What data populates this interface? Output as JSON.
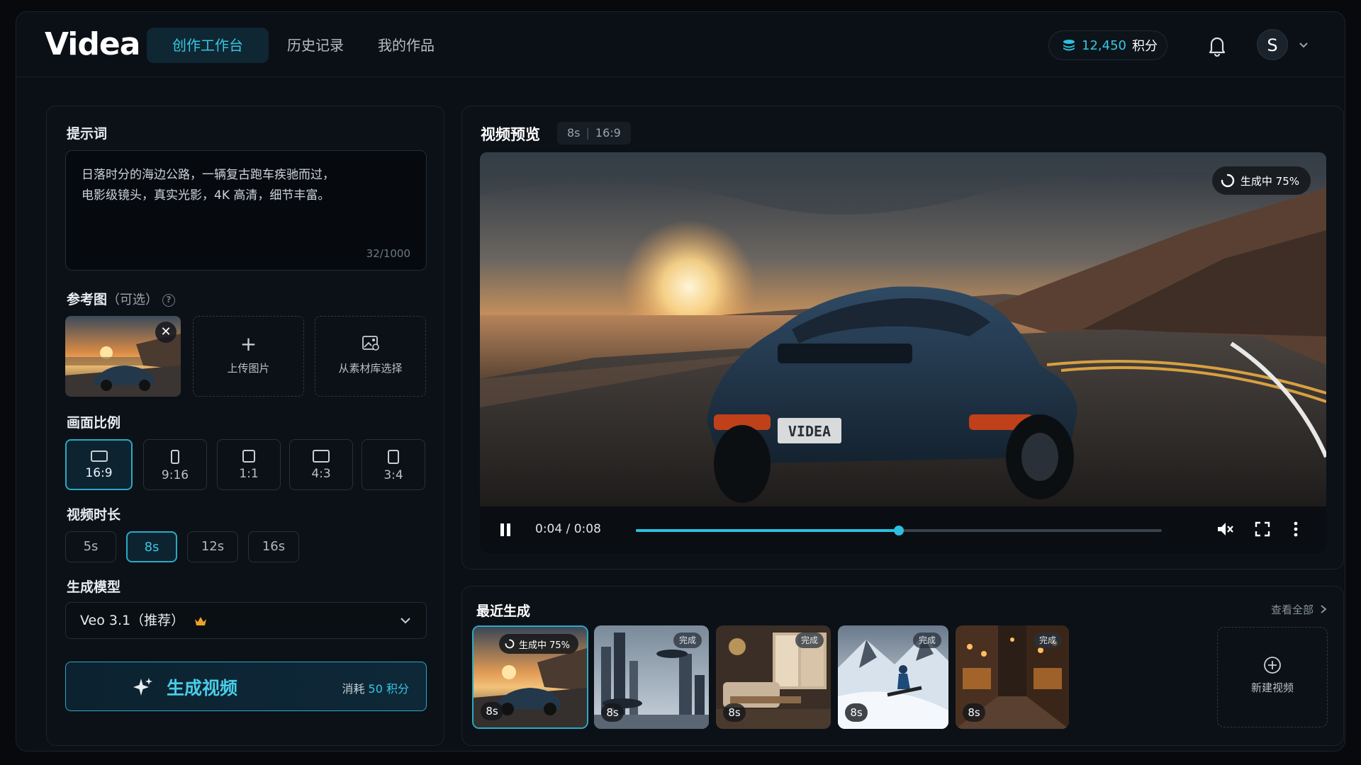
{
  "app": {
    "logo": "Videa"
  },
  "nav": {
    "tabs": [
      {
        "label": "创作工作台",
        "active": true
      },
      {
        "label": "历史记录",
        "active": false
      },
      {
        "label": "我的作品",
        "active": false
      }
    ]
  },
  "header": {
    "credits_value": "12,450",
    "credits_unit": "积分",
    "avatar_initial": "S"
  },
  "left_panel": {
    "prompt_label": "提示词",
    "prompt_lines": [
      "日落时分的海边公路，一辆复古跑车疾驰而过，",
      "电影级镜头，真实光影，4K 高清，细节丰富。"
    ],
    "prompt_count": "32/1000",
    "reference_label": "参考图",
    "reference_sub": "（可选）",
    "upload_label": "上传图片",
    "library_label": "从素材库选择",
    "ratio_label": "画面比例",
    "ratios": [
      "16:9",
      "9:16",
      "1:1",
      "4:3",
      "3:4"
    ],
    "ratio_selected": "16:9",
    "duration_label": "视频时长",
    "durations": [
      "5s",
      "8s",
      "12s",
      "16s"
    ],
    "duration_selected": "8s",
    "model_label": "生成模型",
    "model_value": "Veo 3.1（推荐）",
    "generate_label": "生成视频",
    "cost_prefix": "消耗",
    "cost_value": "50 积分"
  },
  "preview": {
    "title": "视频预览",
    "meta_duration": "8s",
    "meta_ratio": "16:9",
    "status": "生成中 75%",
    "time": "0:04 / 0:08",
    "progress": 0.5,
    "plate": "VIDEA"
  },
  "recent": {
    "title": "最近生成",
    "view_all": "查看全部",
    "items": [
      {
        "duration": "8s",
        "status": "生成中 75%",
        "scene": "sunset-car"
      },
      {
        "duration": "8s",
        "status": "完成",
        "scene": "futuristic-city"
      },
      {
        "duration": "8s",
        "status": "完成",
        "scene": "interior"
      },
      {
        "duration": "8s",
        "status": "完成",
        "scene": "snowboard"
      },
      {
        "duration": "8s",
        "status": "完成",
        "scene": "street-cafe"
      }
    ],
    "new_label": "新建视频"
  },
  "colors": {
    "accent": "#2cc0de",
    "background": "#07090c"
  }
}
